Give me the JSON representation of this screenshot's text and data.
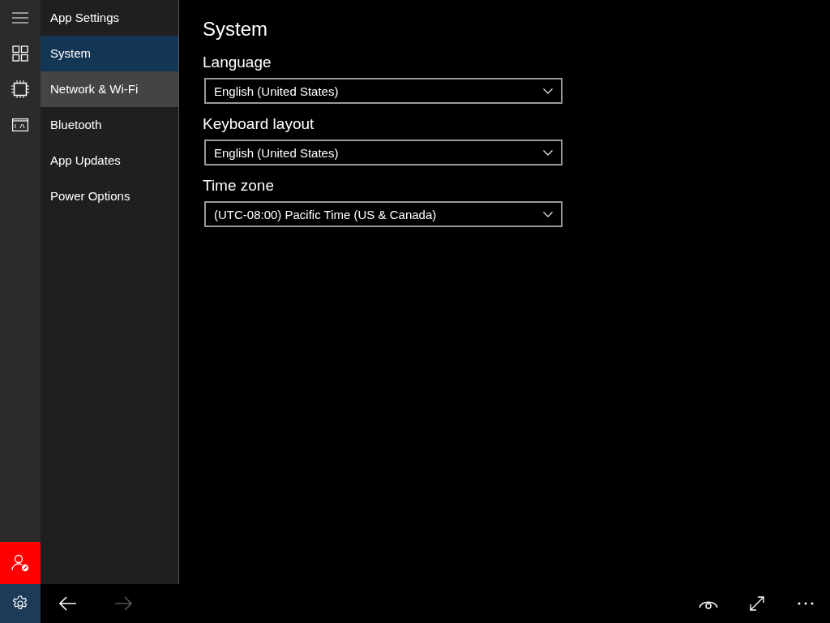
{
  "rail": {
    "icons": [
      {
        "kind": "menu"
      },
      {
        "kind": "tiles"
      },
      {
        "kind": "chip"
      },
      {
        "kind": "console"
      }
    ],
    "account_button": {
      "kind": "user-blocked"
    }
  },
  "sidebar": {
    "title": "App Settings",
    "items": [
      {
        "label": "System",
        "selected": true,
        "hovered": false
      },
      {
        "label": "Network & Wi-Fi",
        "selected": false,
        "hovered": true
      },
      {
        "label": "Bluetooth",
        "selected": false,
        "hovered": false
      },
      {
        "label": "App Updates",
        "selected": false,
        "hovered": false
      },
      {
        "label": "Power Options",
        "selected": false,
        "hovered": false
      }
    ]
  },
  "page": {
    "title": "System",
    "fields": [
      {
        "label": "Language",
        "value": "English (United States)"
      },
      {
        "label": "Keyboard layout",
        "value": "English (United States)"
      },
      {
        "label": "Time zone",
        "value": "(UTC-08:00) Pacific Time (US & Canada)"
      }
    ]
  },
  "bottom_bar": {
    "back_disabled": false,
    "forward_disabled": true
  }
}
